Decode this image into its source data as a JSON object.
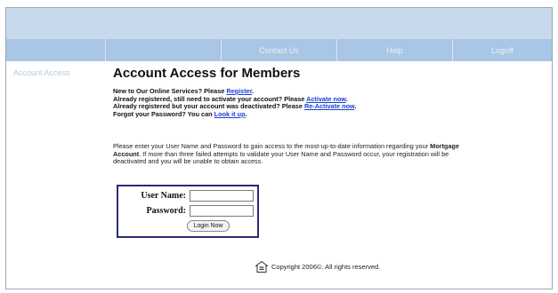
{
  "nav": {
    "items": [
      {
        "label": ""
      },
      {
        "label": ""
      },
      {
        "label": "Contact Us"
      },
      {
        "label": "Help"
      },
      {
        "label": "Logoff"
      }
    ]
  },
  "sidebar": {
    "item_label": "Account Access"
  },
  "main": {
    "title": "Account Access for Members",
    "intro": {
      "line1_text": "New to Our Online Services?  Please ",
      "line1_link": "Register",
      "line2_text": "Already registered, still need to activate your account?  Please ",
      "line2_link": "Activate now",
      "line3_text": "Already registered but your account was deactivated?  Please ",
      "line3_link": "Re-Activate now",
      "line4_text": "Forgot your Password? You can ",
      "line4_link": "Look it up"
    },
    "description": {
      "part1": "Please enter your User Name and Password to gain access to the most-up-to-date information regarding your ",
      "bold": "Mortgage Account",
      "part2": ". If more than three failed attempts to validate your User Name and Password occur, your registration will be deactivated and you will be unable to obtain access."
    }
  },
  "login": {
    "username_label": "User Name:",
    "password_label": "Password:",
    "username_value": "",
    "password_value": "",
    "button_label": "Login Now"
  },
  "footer": {
    "copyright": "Copyright 2006©. All rights reserved.",
    "icon": "equal-housing-icon"
  },
  "colors": {
    "top_band": "#c9d9ec",
    "nav_bar": "#a9c6e4",
    "link": "#1a3fd6",
    "login_border": "#2a2a7a"
  }
}
